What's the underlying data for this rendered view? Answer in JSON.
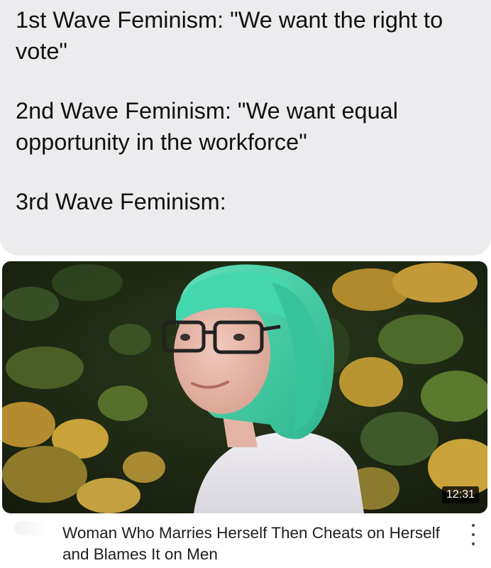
{
  "post": {
    "lines": [
      "1st Wave Feminism: \"We want the right to vote\"",
      "2nd Wave Feminism: \"We want equal opportunity in the workforce\"",
      "3rd Wave Feminism:"
    ]
  },
  "video": {
    "duration": "12:31",
    "title": "Woman Who Marries Herself Then Cheats on Herself and Blames It on Men",
    "menu_icon": "more-vertical-icon"
  },
  "colors": {
    "bubble_bg": "#ececee",
    "hair": "#3fcfa4",
    "foliage_yellow": "#c9a23a",
    "foliage_green": "#3e5a2a"
  }
}
